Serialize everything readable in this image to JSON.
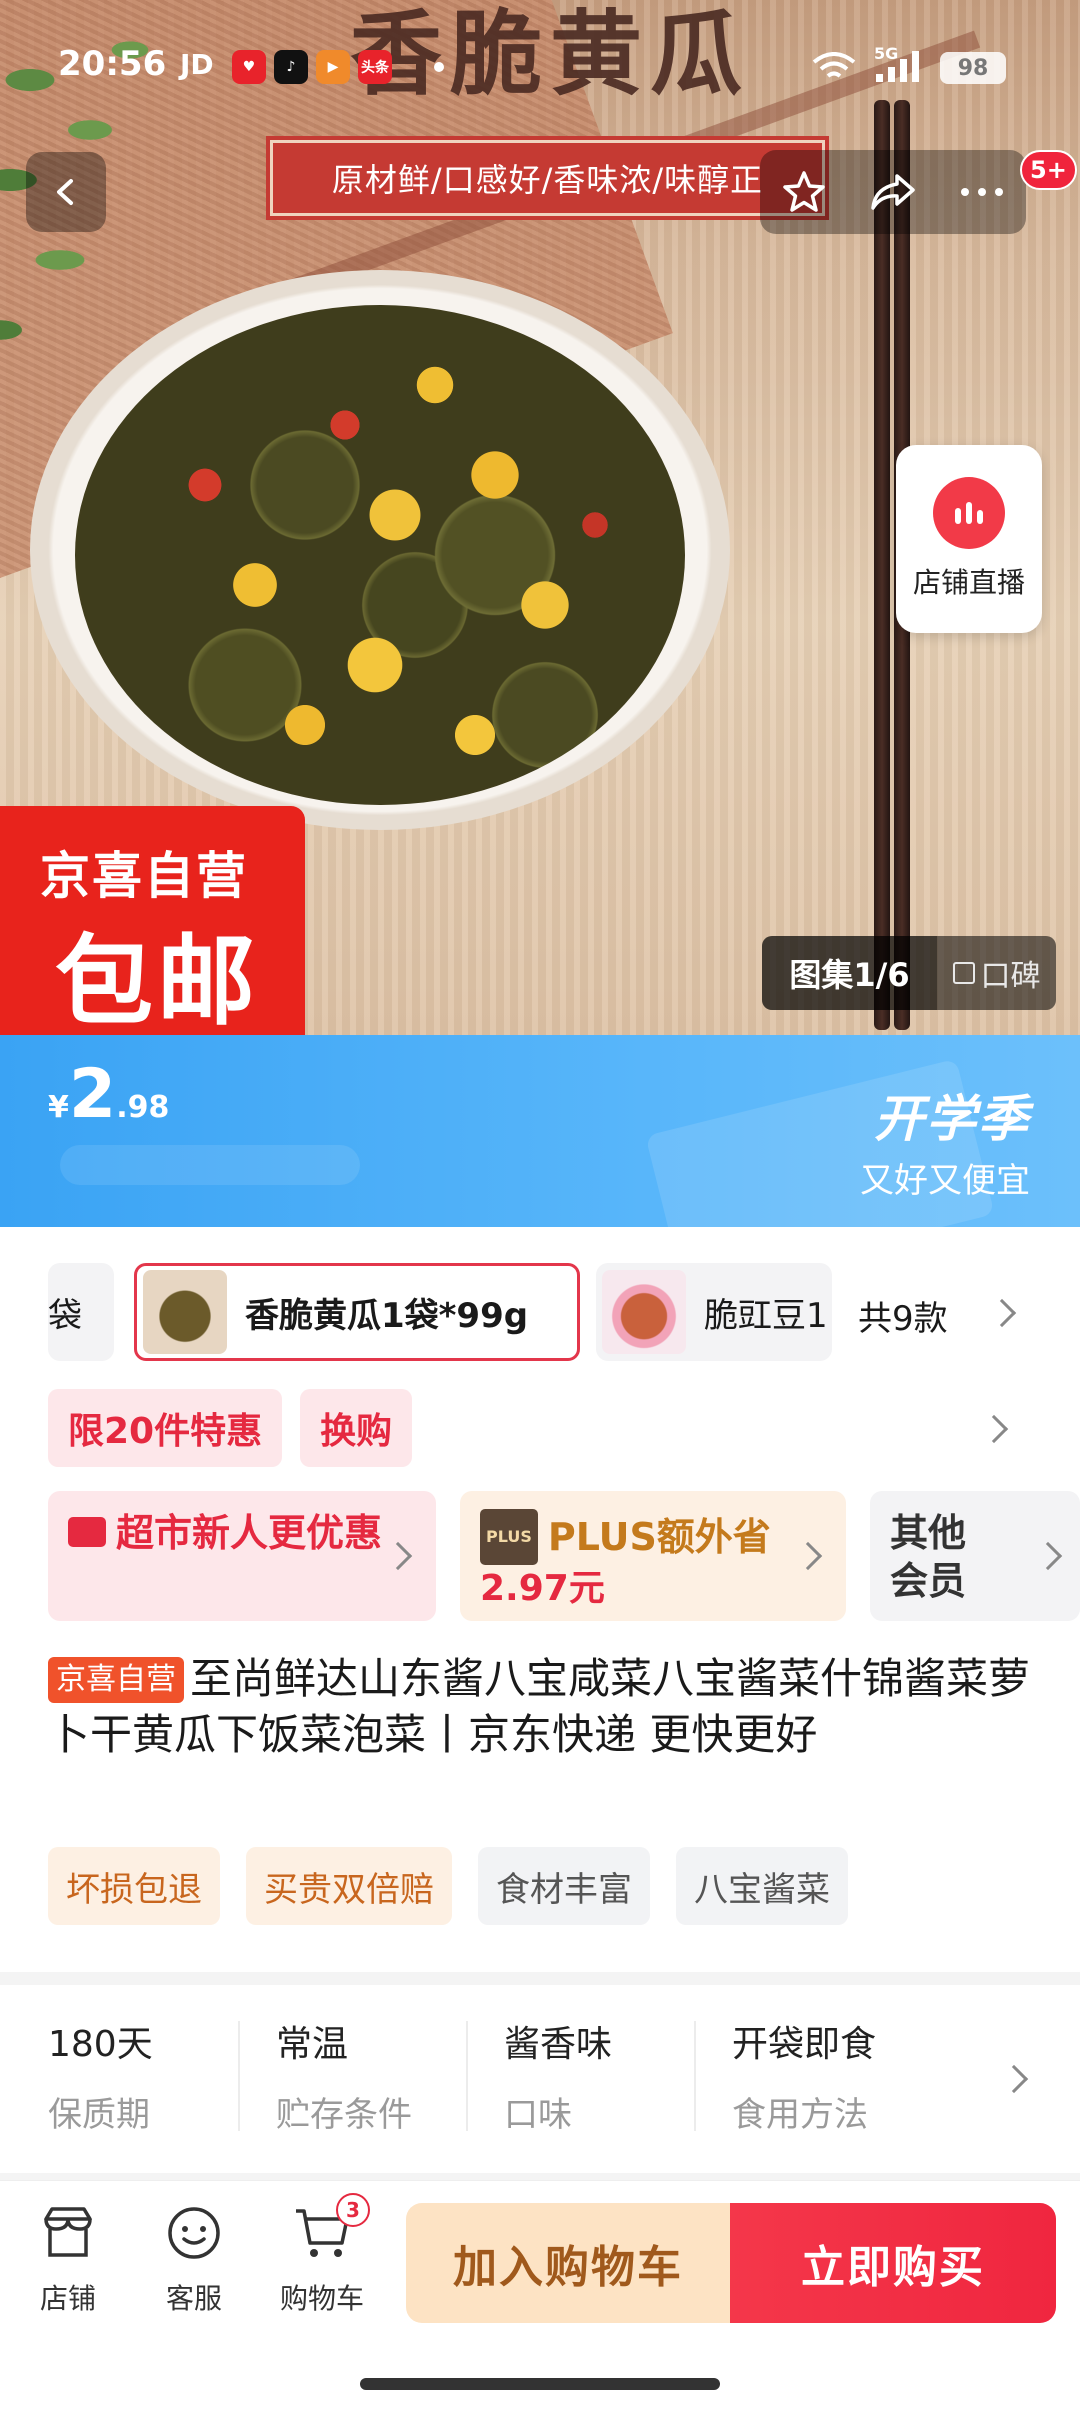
{
  "status_bar": {
    "time": "20:56",
    "carrier": "JD",
    "app_icons": [
      {
        "name": "heart-app-icon",
        "color": "#e8232b"
      },
      {
        "name": "douyin-icon",
        "color": "#111111"
      },
      {
        "name": "video-app-icon",
        "color": "#f08a2b"
      },
      {
        "name": "toutiao-icon",
        "label": "头条",
        "color": "#e8232b"
      }
    ],
    "network": "5G",
    "battery": "98"
  },
  "hero": {
    "product_title_art": "香脆黄瓜",
    "slogan": "原材鲜/口感好/香味浓/味醇正",
    "promo_line1": "京喜自营",
    "promo_line2": "包邮",
    "live_label": "店铺直播",
    "gallery_label": "图集1/6",
    "reviews_label": "口碑",
    "message_badge": "5+"
  },
  "price_banner": {
    "currency": "¥",
    "price_int": "2",
    "price_dec": ".98",
    "campaign_title": "开学季",
    "campaign_sub": "又好又便宜",
    "color": "#3aa3f4"
  },
  "variants": {
    "prev_label": "袋",
    "selected_label": "香脆黄瓜1袋*99g",
    "next_label": "脆豇豆1",
    "count_label": "共9款"
  },
  "promo_tags": [
    "限20件特惠",
    "换购"
  ],
  "benefits": {
    "newcomer": "超市新人更优惠",
    "plus_badge": "PLUS",
    "plus_title": "PLUS额外省",
    "plus_amount": "2.97元",
    "other": "其他会员"
  },
  "product": {
    "badge": "京喜自营",
    "title": "至尚鲜达山东酱八宝咸菜八宝酱菜什锦酱菜萝卜干黄瓜下饭菜泡菜丨京东快递 更快更好"
  },
  "service_tags": [
    "坏损包退",
    "买贵双倍赔"
  ],
  "feature_tags": [
    "食材丰富",
    "八宝酱菜"
  ],
  "specs": [
    {
      "value": "180天",
      "key": "保质期"
    },
    {
      "value": "常温",
      "key": "贮存条件"
    },
    {
      "value": "酱香味",
      "key": "口味"
    },
    {
      "value": "开袋即食",
      "key": "食用方法"
    }
  ],
  "bottom_bar": {
    "shop": "店铺",
    "service": "客服",
    "cart": "购物车",
    "cart_count": "3",
    "add_to_cart": "加入购物车",
    "buy_now": "立即购买",
    "accent": "#f0263f"
  }
}
